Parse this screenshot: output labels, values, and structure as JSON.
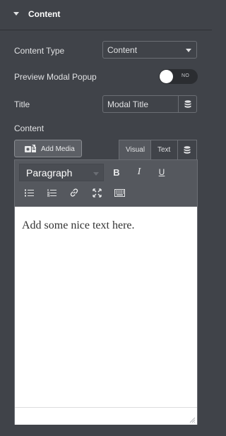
{
  "section": {
    "title": "Content"
  },
  "fields": {
    "content_type": {
      "label": "Content Type",
      "value": "Content"
    },
    "preview_modal": {
      "label": "Preview Modal Popup",
      "state": "NO"
    },
    "title": {
      "label": "Title",
      "value": "Modal Title"
    },
    "content": {
      "label": "Content"
    }
  },
  "editor": {
    "add_media_label": "Add Media",
    "tabs": {
      "visual": "Visual",
      "text": "Text"
    },
    "active_tab": "Visual",
    "format_value": "Paragraph",
    "toolbar": {
      "bold": "B",
      "italic": "I",
      "underline": "U"
    },
    "body_text": "Add some nice text here."
  },
  "colors": {
    "panel_bg": "#404349",
    "toolbar_bg": "#55585e",
    "text": "#e0e1e3"
  }
}
